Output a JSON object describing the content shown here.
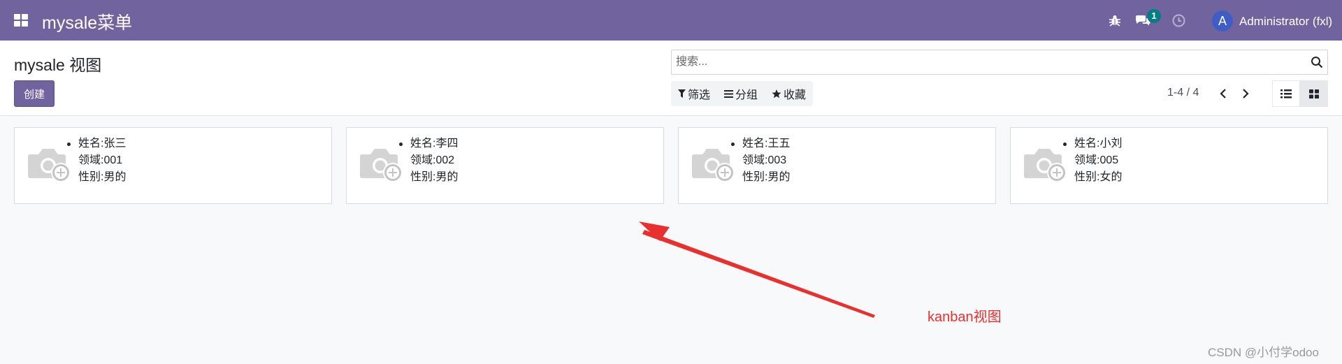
{
  "navbar": {
    "brand": "mysale菜单",
    "notification_count": "1",
    "avatar_letter": "A",
    "username": "Administrator (fxl)",
    "color": "#71639e"
  },
  "control_panel": {
    "title": "mysale 视图",
    "create_label": "创建",
    "search_placeholder": "搜索...",
    "filter_label": "筛选",
    "group_label": "分组",
    "favorite_label": "收藏",
    "pager": "1-4 / 4"
  },
  "cards": [
    {
      "name": "姓名:张三",
      "domain": "领域:001",
      "gender": "性别:男的"
    },
    {
      "name": "姓名:李四",
      "domain": "领域:002",
      "gender": "性别:男的"
    },
    {
      "name": "姓名:王五",
      "domain": "领域:003",
      "gender": "性别:男的"
    },
    {
      "name": "姓名:小刘",
      "domain": "领域:005",
      "gender": "性别:女的"
    }
  ],
  "annotation": "kanban视图",
  "watermark": "CSDN @小付学odoo",
  "icons": [
    "apps-icon",
    "bug-icon",
    "chat-icon",
    "clock-icon",
    "search-icon",
    "filter-icon",
    "group-icon",
    "star-icon",
    "chevron-left-icon",
    "chevron-right-icon",
    "list-view-icon",
    "kanban-view-icon",
    "camera-add-icon"
  ]
}
